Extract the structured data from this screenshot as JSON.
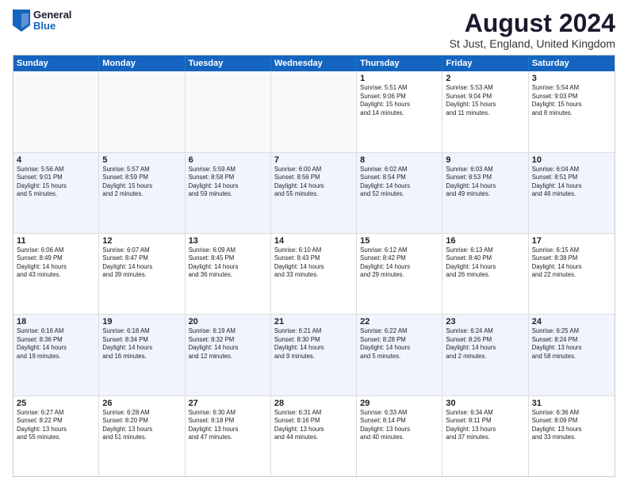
{
  "logo": {
    "general": "General",
    "blue": "Blue"
  },
  "title": "August 2024",
  "location": "St Just, England, United Kingdom",
  "days": [
    "Sunday",
    "Monday",
    "Tuesday",
    "Wednesday",
    "Thursday",
    "Friday",
    "Saturday"
  ],
  "rows": [
    [
      {
        "day": "",
        "info": ""
      },
      {
        "day": "",
        "info": ""
      },
      {
        "day": "",
        "info": ""
      },
      {
        "day": "",
        "info": ""
      },
      {
        "day": "1",
        "info": "Sunrise: 5:51 AM\nSunset: 9:06 PM\nDaylight: 15 hours\nand 14 minutes."
      },
      {
        "day": "2",
        "info": "Sunrise: 5:53 AM\nSunset: 9:04 PM\nDaylight: 15 hours\nand 11 minutes."
      },
      {
        "day": "3",
        "info": "Sunrise: 5:54 AM\nSunset: 9:03 PM\nDaylight: 15 hours\nand 8 minutes."
      }
    ],
    [
      {
        "day": "4",
        "info": "Sunrise: 5:56 AM\nSunset: 9:01 PM\nDaylight: 15 hours\nand 5 minutes."
      },
      {
        "day": "5",
        "info": "Sunrise: 5:57 AM\nSunset: 8:59 PM\nDaylight: 15 hours\nand 2 minutes."
      },
      {
        "day": "6",
        "info": "Sunrise: 5:59 AM\nSunset: 8:58 PM\nDaylight: 14 hours\nand 59 minutes."
      },
      {
        "day": "7",
        "info": "Sunrise: 6:00 AM\nSunset: 8:56 PM\nDaylight: 14 hours\nand 55 minutes."
      },
      {
        "day": "8",
        "info": "Sunrise: 6:02 AM\nSunset: 8:54 PM\nDaylight: 14 hours\nand 52 minutes."
      },
      {
        "day": "9",
        "info": "Sunrise: 6:03 AM\nSunset: 8:53 PM\nDaylight: 14 hours\nand 49 minutes."
      },
      {
        "day": "10",
        "info": "Sunrise: 6:04 AM\nSunset: 8:51 PM\nDaylight: 14 hours\nand 46 minutes."
      }
    ],
    [
      {
        "day": "11",
        "info": "Sunrise: 6:06 AM\nSunset: 8:49 PM\nDaylight: 14 hours\nand 43 minutes."
      },
      {
        "day": "12",
        "info": "Sunrise: 6:07 AM\nSunset: 8:47 PM\nDaylight: 14 hours\nand 39 minutes."
      },
      {
        "day": "13",
        "info": "Sunrise: 6:09 AM\nSunset: 8:45 PM\nDaylight: 14 hours\nand 36 minutes."
      },
      {
        "day": "14",
        "info": "Sunrise: 6:10 AM\nSunset: 8:43 PM\nDaylight: 14 hours\nand 33 minutes."
      },
      {
        "day": "15",
        "info": "Sunrise: 6:12 AM\nSunset: 8:42 PM\nDaylight: 14 hours\nand 29 minutes."
      },
      {
        "day": "16",
        "info": "Sunrise: 6:13 AM\nSunset: 8:40 PM\nDaylight: 14 hours\nand 26 minutes."
      },
      {
        "day": "17",
        "info": "Sunrise: 6:15 AM\nSunset: 8:38 PM\nDaylight: 14 hours\nand 22 minutes."
      }
    ],
    [
      {
        "day": "18",
        "info": "Sunrise: 6:16 AM\nSunset: 8:36 PM\nDaylight: 14 hours\nand 19 minutes."
      },
      {
        "day": "19",
        "info": "Sunrise: 6:18 AM\nSunset: 8:34 PM\nDaylight: 14 hours\nand 16 minutes."
      },
      {
        "day": "20",
        "info": "Sunrise: 6:19 AM\nSunset: 8:32 PM\nDaylight: 14 hours\nand 12 minutes."
      },
      {
        "day": "21",
        "info": "Sunrise: 6:21 AM\nSunset: 8:30 PM\nDaylight: 14 hours\nand 9 minutes."
      },
      {
        "day": "22",
        "info": "Sunrise: 6:22 AM\nSunset: 8:28 PM\nDaylight: 14 hours\nand 5 minutes."
      },
      {
        "day": "23",
        "info": "Sunrise: 6:24 AM\nSunset: 8:26 PM\nDaylight: 14 hours\nand 2 minutes."
      },
      {
        "day": "24",
        "info": "Sunrise: 6:25 AM\nSunset: 8:24 PM\nDaylight: 13 hours\nand 58 minutes."
      }
    ],
    [
      {
        "day": "25",
        "info": "Sunrise: 6:27 AM\nSunset: 8:22 PM\nDaylight: 13 hours\nand 55 minutes."
      },
      {
        "day": "26",
        "info": "Sunrise: 6:28 AM\nSunset: 8:20 PM\nDaylight: 13 hours\nand 51 minutes."
      },
      {
        "day": "27",
        "info": "Sunrise: 6:30 AM\nSunset: 8:18 PM\nDaylight: 13 hours\nand 47 minutes."
      },
      {
        "day": "28",
        "info": "Sunrise: 6:31 AM\nSunset: 8:16 PM\nDaylight: 13 hours\nand 44 minutes."
      },
      {
        "day": "29",
        "info": "Sunrise: 6:33 AM\nSunset: 8:14 PM\nDaylight: 13 hours\nand 40 minutes."
      },
      {
        "day": "30",
        "info": "Sunrise: 6:34 AM\nSunset: 8:11 PM\nDaylight: 13 hours\nand 37 minutes."
      },
      {
        "day": "31",
        "info": "Sunrise: 6:36 AM\nSunset: 8:09 PM\nDaylight: 13 hours\nand 33 minutes."
      }
    ]
  ],
  "row_alt": [
    false,
    true,
    false,
    true,
    false
  ]
}
